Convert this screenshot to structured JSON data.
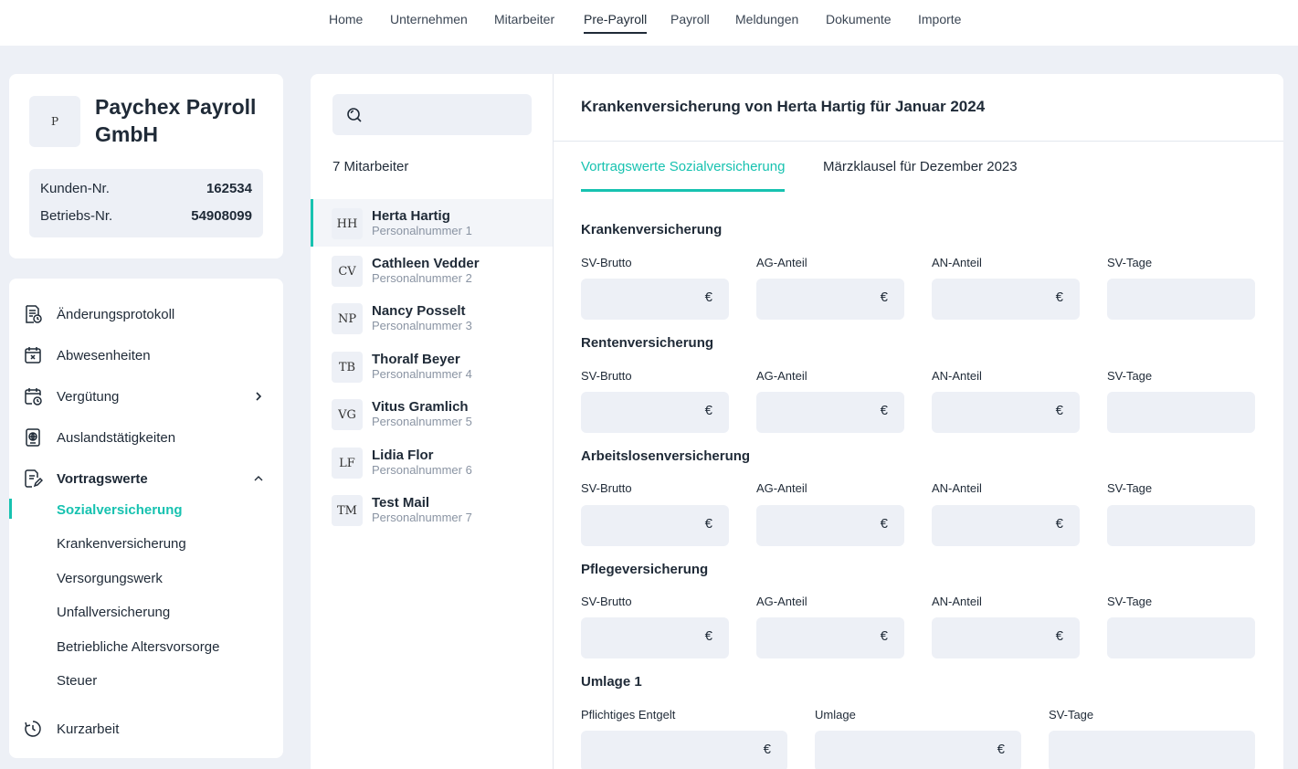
{
  "nav": {
    "items": [
      "Home",
      "Unternehmen",
      "Mitarbeiter",
      "Pre-Payroll",
      "Payroll",
      "Meldungen",
      "Dokumente",
      "Importe"
    ],
    "active": "Pre-Payroll"
  },
  "company": {
    "logo_initial": "P",
    "name": "Paychex Payroll GmbH",
    "customer_label": "Kunden-Nr.",
    "customer_value": "162534",
    "operation_label": "Betriebs-Nr.",
    "operation_value": "54908099"
  },
  "sidebar": {
    "items": [
      {
        "label": "Änderungsprotokoll",
        "icon": "document-clock-icon"
      },
      {
        "label": "Abwesenheiten",
        "icon": "calendar-x-icon"
      },
      {
        "label": "Vergütung",
        "icon": "calendar-clock-icon"
      },
      {
        "label": "Auslandstätigkeiten",
        "icon": "passport-icon"
      },
      {
        "label": "Vortragswerte",
        "icon": "edit-document-icon"
      },
      {
        "label": "Kurzarbeit",
        "icon": "timer-icon"
      }
    ],
    "submenu": [
      {
        "label": "Sozialversicherung",
        "active": true
      },
      {
        "label": "Krankenversicherung",
        "active": false
      },
      {
        "label": "Versorgungswerk",
        "active": false
      },
      {
        "label": "Unfallversicherung",
        "active": false
      },
      {
        "label": "Betriebliche Altersvorsorge",
        "active": false
      },
      {
        "label": "Steuer",
        "active": false
      }
    ]
  },
  "employees": {
    "search_placeholder": "",
    "count_label": "7 Mitarbeiter",
    "list": [
      {
        "initials": "HH",
        "name": "Herta Hartig",
        "number": "Personalnummer 1",
        "active": true
      },
      {
        "initials": "CV",
        "name": "Cathleen Vedder",
        "number": "Personalnummer 2",
        "active": false
      },
      {
        "initials": "NP",
        "name": "Nancy Posselt",
        "number": "Personalnummer 3",
        "active": false
      },
      {
        "initials": "TB",
        "name": "Thoralf Beyer",
        "number": "Personalnummer 4",
        "active": false
      },
      {
        "initials": "VG",
        "name": "Vitus Gramlich",
        "number": "Personalnummer 5",
        "active": false
      },
      {
        "initials": "LF",
        "name": "Lidia Flor",
        "number": "Personalnummer 6",
        "active": false
      },
      {
        "initials": "TM",
        "name": "Test Mail",
        "number": "Personalnummer 7",
        "active": false
      }
    ]
  },
  "main": {
    "title": "Krankenversicherung von Herta Hartig für Januar 2024",
    "tabs": [
      {
        "label": "Vortragswerte Sozialversicherung",
        "active": true
      },
      {
        "label": "Märzklausel für Dezember 2023",
        "active": false
      }
    ],
    "currency": "€",
    "sections": [
      {
        "title": "Krankenversicherung",
        "fields": [
          {
            "label": "SV-Brutto",
            "currency": true,
            "value": ""
          },
          {
            "label": "AG-Anteil",
            "currency": true,
            "value": ""
          },
          {
            "label": "AN-Anteil",
            "currency": true,
            "value": ""
          },
          {
            "label": "SV-Tage",
            "currency": false,
            "value": ""
          }
        ]
      },
      {
        "title": "Rentenversicherung",
        "fields": [
          {
            "label": "SV-Brutto",
            "currency": true,
            "value": ""
          },
          {
            "label": "AG-Anteil",
            "currency": true,
            "value": ""
          },
          {
            "label": "AN-Anteil",
            "currency": true,
            "value": ""
          },
          {
            "label": "SV-Tage",
            "currency": false,
            "value": ""
          }
        ]
      },
      {
        "title": "Arbeitslosenversicherung",
        "fields": [
          {
            "label": "SV-Brutto",
            "currency": true,
            "value": ""
          },
          {
            "label": "AG-Anteil",
            "currency": true,
            "value": ""
          },
          {
            "label": "AN-Anteil",
            "currency": true,
            "value": ""
          },
          {
            "label": "SV-Tage",
            "currency": false,
            "value": ""
          }
        ]
      },
      {
        "title": "Pflegeversicherung",
        "fields": [
          {
            "label": "SV-Brutto",
            "currency": true,
            "value": ""
          },
          {
            "label": "AG-Anteil",
            "currency": true,
            "value": ""
          },
          {
            "label": "AN-Anteil",
            "currency": true,
            "value": ""
          },
          {
            "label": "SV-Tage",
            "currency": false,
            "value": ""
          }
        ]
      },
      {
        "title": "Umlage 1",
        "fields": [
          {
            "label": "Pflichtiges Entgelt",
            "currency": true,
            "value": ""
          },
          {
            "label": "Umlage",
            "currency": true,
            "value": ""
          },
          {
            "label": "SV-Tage",
            "currency": false,
            "value": ""
          }
        ]
      }
    ]
  },
  "colors": {
    "accent": "#17c2b0",
    "background": "#edf0f6",
    "text": "#1f2a37"
  }
}
